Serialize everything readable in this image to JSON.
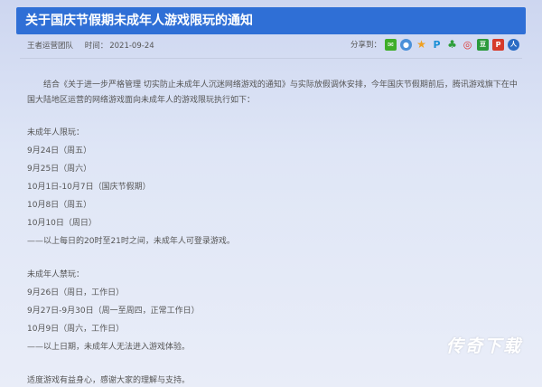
{
  "header": {
    "title": "关于国庆节假期未成年人游戏限玩的通知"
  },
  "meta": {
    "author": "王者运营团队",
    "time_label": "时间：",
    "date": "2021-09-24"
  },
  "share": {
    "label": "分享到：",
    "icons": [
      {
        "name": "wechat-icon",
        "color": "#3fae29",
        "glyph": "✉"
      },
      {
        "name": "qzone-icon",
        "color": "#4a90d9",
        "glyph": "●"
      },
      {
        "name": "star-icon",
        "color": "#f0a020",
        "glyph": "★"
      },
      {
        "name": "p-icon",
        "color": "#1a8fd6",
        "glyph": "P"
      },
      {
        "name": "clover-icon",
        "color": "#2e9e3a",
        "glyph": "♣"
      },
      {
        "name": "weibo-icon",
        "color": "#e0312d",
        "glyph": "◎"
      },
      {
        "name": "douban-icon",
        "color": "#2c9a3c",
        "glyph": "豆"
      },
      {
        "name": "renren-icon",
        "color": "#d63a2a",
        "glyph": "P"
      },
      {
        "name": "person-icon",
        "color": "#2b6cc4",
        "glyph": "人"
      }
    ]
  },
  "content": {
    "intro": "结合《关于进一步严格管理 切实防止未成年人沉迷网络游戏的通知》与实际放假调休安排，今年国庆节假期前后，腾讯游戏旗下在中国大陆地区运营的网络游戏面向未成年人的游戏限玩执行如下：",
    "allowed_heading": "未成年人限玩：",
    "allowed": [
      "9月24日（周五）",
      "9月25日（周六）",
      "10月1日-10月7日（国庆节假期）",
      "10月8日（周五）",
      "10月10日（周日）",
      "——以上每日的20时至21时之间，未成年人可登录游戏。"
    ],
    "banned_heading": "未成年人禁玩：",
    "banned": [
      "9月26日（周日，工作日）",
      "9月27日-9月30日（周一至周四，正常工作日）",
      "10月9日（周六，工作日）",
      "——以上日期，未成年人无法进入游戏体验。"
    ],
    "closing": "适度游戏有益身心，感谢大家的理解与支持。"
  },
  "watermark": "传奇下载"
}
